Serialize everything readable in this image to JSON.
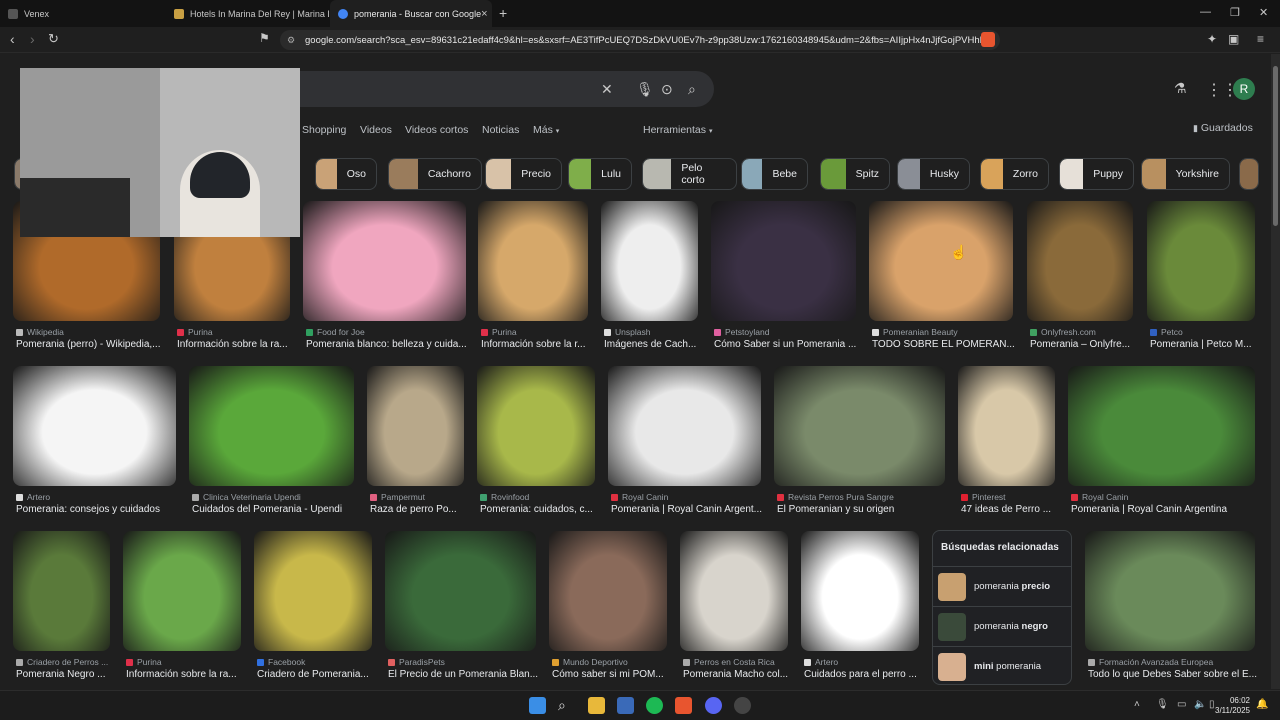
{
  "browser": {
    "tabs": [
      {
        "title": "Venex",
        "color": "#555555"
      },
      {
        "title": "Hotels In Marina Del Rey | Marina De",
        "color": "#c9a043"
      },
      {
        "title": "pomerania - Buscar con Google",
        "color": "#4285f4"
      }
    ],
    "address": "google.com/search?sca_esv=89631c21edaff4c9&hl=es&sxsrf=AE3TifPcUEQ7DSzDkVU0Ev7h-z9pp38Uzw:1762160348945&udm=2&fbs=AIIjpHx4nJjfGojPVHhE...",
    "close_tab_glyph": "×",
    "new_tab_glyph": "+"
  },
  "google": {
    "clear_glyph": "✕",
    "search_tabs": [
      "Shopping",
      "Videos",
      "Videos cortos",
      "Noticias",
      "Más",
      "Herramientas"
    ],
    "saved_label": "Guardados",
    "avatar_letter": "R",
    "chips": [
      {
        "label": "Oso",
        "color": "#c9a277"
      },
      {
        "label": "Cachorro",
        "color": "#9a7c5c"
      },
      {
        "label": "Precio",
        "color": "#d8c2a8"
      },
      {
        "label": "Lulu",
        "color": "#7fae4a"
      },
      {
        "label": "Pelo corto",
        "color": "#b8b8b0"
      },
      {
        "label": "Bebe",
        "color": "#8aa8b8"
      },
      {
        "label": "Spitz",
        "color": "#6a9a3a"
      },
      {
        "label": "Husky",
        "color": "#8a8e96"
      },
      {
        "label": "Zorro",
        "color": "#d9a35a"
      },
      {
        "label": "Puppy",
        "color": "#e6e0d8"
      },
      {
        "label": "Yorkshire",
        "color": "#b89060"
      }
    ],
    "results": [
      {
        "source": "Wikipedia",
        "title": "Pomerania (perro) - Wikipedia,...",
        "color": "#b06a2a",
        "iconColor": "#bbbbbb"
      },
      {
        "source": "Purina",
        "title": "Información sobre la ra...",
        "color": "#c0803e",
        "iconColor": "#e0304a"
      },
      {
        "source": "Food for Joe",
        "title": "Pomerania blanco: belleza y cuida...",
        "color": "#f0a6bf",
        "iconColor": "#30a060"
      },
      {
        "source": "Purina",
        "title": "Información sobre la r...",
        "color": "#d6a86a",
        "iconColor": "#e0304a"
      },
      {
        "source": "Unsplash",
        "title": "Imágenes de Cach...",
        "color": "#eeeeee",
        "iconColor": "#dddddd"
      },
      {
        "source": "Petstoyland",
        "title": "Cómo Saber si un Pomerania ...",
        "color": "#3a3044",
        "iconColor": "#e060a0"
      },
      {
        "source": "Pomeranian Beauty",
        "title": "TODO SOBRE EL POMERAN...",
        "color": "#d9a26a",
        "iconColor": "#dddddd"
      },
      {
        "source": "Onlyfresh.com",
        "title": "Pomerania – Onlyfre...",
        "color": "#8a6a3a",
        "iconColor": "#40a060"
      },
      {
        "source": "Petco",
        "title": "Pomerania | Petco M...",
        "color": "#6a8a3a",
        "iconColor": "#3060c0"
      },
      {
        "source": "Artero",
        "title": "Pomerania: consejos y cuidados",
        "color": "#f5f5f5",
        "iconColor": "#dddddd"
      },
      {
        "source": "Clinica Veterinaria Upendi",
        "title": "Cuidados del Pomerania - Upendi",
        "color": "#5aa83a",
        "iconColor": "#aaaaaa"
      },
      {
        "source": "Pampermut",
        "title": "Raza de perro Po...",
        "color": "#b8a88a",
        "iconColor": "#e06080"
      },
      {
        "source": "Rovinfood",
        "title": "Pomerania: cuidados, c...",
        "color": "#a8b84a",
        "iconColor": "#40a070"
      },
      {
        "source": "Royal Canin",
        "title": "Pomerania | Royal Canin Argent...",
        "color": "#e8e8e8",
        "iconColor": "#e03040"
      },
      {
        "source": "Revista Perros Pura Sangre",
        "title": "El Pomeranian y su origen",
        "color": "#7a8a6a",
        "iconColor": "#e03040"
      },
      {
        "source": "Pinterest",
        "title": "47 ideas de Perro ...",
        "color": "#d8c8a8",
        "iconColor": "#e02030"
      },
      {
        "source": "Royal Canin",
        "title": "Pomerania | Royal Canin Argentina",
        "color": "#4a8a3a",
        "iconColor": "#e03040"
      },
      {
        "source": "Criadero de Perros ...",
        "title": "Pomerania Negro ...",
        "color": "#5a7a3a",
        "iconColor": "#aaaaaa"
      },
      {
        "source": "Purina",
        "title": "Información sobre la ra...",
        "color": "#6aa84a",
        "iconColor": "#e0304a"
      },
      {
        "source": "Facebook",
        "title": "Criadero de Pomerania...",
        "color": "#c8b84a",
        "iconColor": "#3070e0"
      },
      {
        "source": "ParadisPets",
        "title": "El Precio de un Pomerania Blan...",
        "color": "#3a6a3a",
        "iconColor": "#e06060"
      },
      {
        "source": "Mundo Deportivo",
        "title": "Cómo saber si mi POM...",
        "color": "#8a6a5a",
        "iconColor": "#e0a030"
      },
      {
        "source": "Perros en Costa Rica",
        "title": "Pomerania Macho col...",
        "color": "#d8d4cc",
        "iconColor": "#aaaaaa"
      },
      {
        "source": "Artero",
        "title": "Cuidados para el perro ...",
        "color": "#ffffff",
        "iconColor": "#dddddd"
      },
      {
        "source": "Formación Avanzada Europea",
        "title": "Todo lo que Debes Saber sobre el E...",
        "color": "#6a8a5a",
        "iconColor": "#aaaaaa"
      }
    ],
    "related": {
      "heading": "Búsquedas relacionadas",
      "items": [
        {
          "pre": "pomerania ",
          "bold": "precio",
          "post": "",
          "color": "#c8a070"
        },
        {
          "pre": "pomerania ",
          "bold": "negro",
          "post": "",
          "color": "#3a4a3a"
        },
        {
          "pre": "",
          "bold": "mini",
          "post": " pomerania",
          "color": "#d8b090"
        }
      ]
    }
  },
  "taskbar": {
    "time": "06:02",
    "date": "3/11/2025"
  }
}
